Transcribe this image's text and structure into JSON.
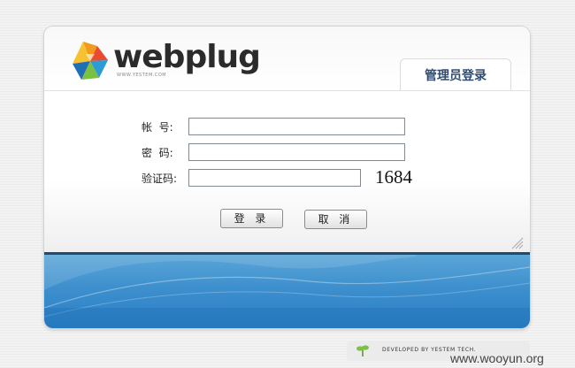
{
  "brand": {
    "name": "webplug",
    "subtitle": "WWW.YESTEM.COM",
    "logo_icon": "pinwheel-logo-icon"
  },
  "tab": {
    "label": "管理员登录"
  },
  "form": {
    "account_label": "帐  号:",
    "account_value": "",
    "password_label": "密  码:",
    "password_value": "",
    "captcha_label": "验证码:",
    "captcha_value": "",
    "captcha_code": "1684"
  },
  "buttons": {
    "login": "登 录",
    "cancel": "取 消"
  },
  "footer": {
    "text": "DEVELOPED BY YESTEM TECH.",
    "icon": "sprout-icon"
  },
  "watermark": "www.wooyun.org",
  "colors": {
    "tab_text": "#2f4b6e",
    "divider": "#23496f",
    "water_top": "#5ba6d8",
    "water_bottom": "#2a7fc6"
  }
}
